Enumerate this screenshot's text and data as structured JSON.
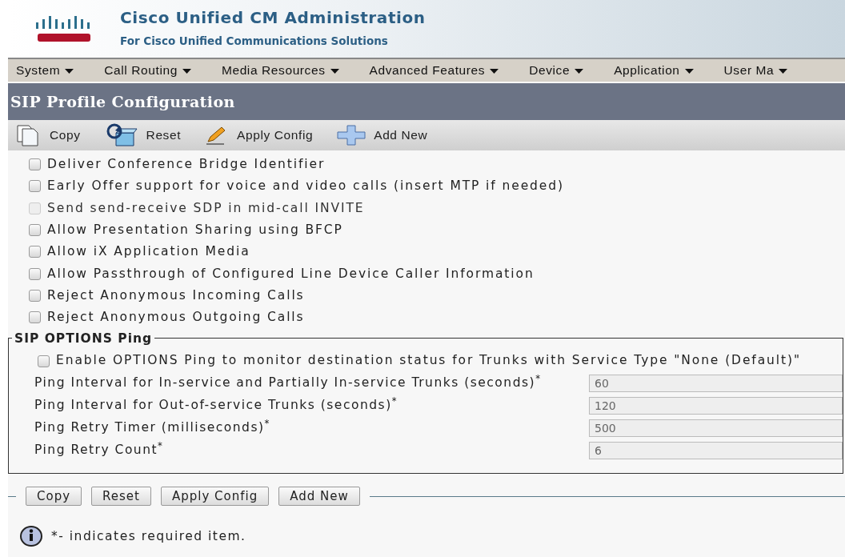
{
  "header": {
    "title": "Cisco Unified CM Administration",
    "subtitle": "For Cisco Unified Communications Solutions"
  },
  "menu": [
    "System",
    "Call Routing",
    "Media Resources",
    "Advanced Features",
    "Device",
    "Application",
    "User Ma"
  ],
  "page_title": "SIP Profile Configuration",
  "toolbar": [
    {
      "kind": "copy",
      "label": "Copy"
    },
    {
      "kind": "reset",
      "label": "Reset"
    },
    {
      "kind": "apply",
      "label": "Apply Config"
    },
    {
      "kind": "add",
      "label": "Add New"
    }
  ],
  "options": [
    {
      "label": "Deliver Conference Bridge Identifier",
      "checked": false,
      "disabled": false
    },
    {
      "label": "Early Offer support for voice and video calls (insert MTP if needed)",
      "checked": false,
      "disabled": false
    },
    {
      "label": "Send send-receive SDP in mid-call INVITE",
      "checked": false,
      "disabled": true
    },
    {
      "label": "Allow Presentation Sharing using BFCP",
      "checked": false,
      "disabled": false
    },
    {
      "label": "Allow iX Application Media",
      "checked": false,
      "disabled": false
    },
    {
      "label": "Allow Passthrough of Configured Line Device Caller Information",
      "checked": false,
      "disabled": false
    },
    {
      "label": "Reject Anonymous Incoming Calls",
      "checked": false,
      "disabled": false
    },
    {
      "label": "Reject Anonymous Outgoing Calls",
      "checked": false,
      "disabled": false
    }
  ],
  "ping": {
    "legend": "SIP OPTIONS Ping",
    "enable": {
      "label": "Enable OPTIONS Ping to monitor destination status for Trunks with Service Type \"None (Default)\"",
      "checked": false
    },
    "fields": [
      {
        "label": "Ping Interval for In-service and Partially In-service Trunks (seconds)$^{*}$",
        "value": "60"
      },
      {
        "label": "Ping Interval for Out-of-service Trunks (seconds)$^{*}$",
        "value": "120"
      },
      {
        "label": "Ping Retry Timer (milliseconds)$^{*}$",
        "value": "500"
      },
      {
        "label": "Ping Retry Count$^{*}$",
        "value": "6"
      }
    ]
  },
  "buttons": [
    "Copy",
    "Reset",
    "Apply Config",
    "Add New"
  ],
  "note": "*- indicates required item."
}
